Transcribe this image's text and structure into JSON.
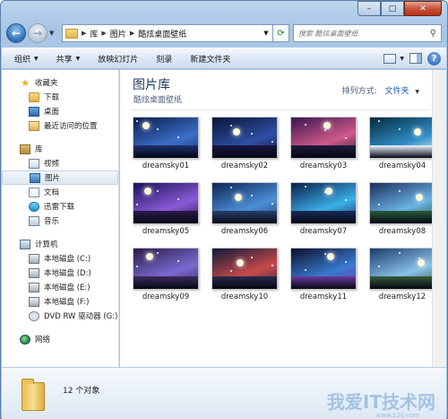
{
  "window": {
    "caption": {
      "minimize": "–",
      "maximize": "□",
      "close": "✕"
    }
  },
  "address": {
    "breadcrumbs": [
      "库",
      "图片",
      "酷炫桌面壁纸"
    ],
    "search_placeholder": "搜索 酷炫桌面壁纸"
  },
  "toolbar": {
    "organize": "组织",
    "share": "共享",
    "slideshow": "放映幻灯片",
    "burn": "刻录",
    "new_folder": "新建文件夹"
  },
  "nav": {
    "favorites": {
      "header": "收藏夹",
      "items": [
        "下载",
        "桌面",
        "最近访问的位置"
      ]
    },
    "libraries": {
      "header": "库",
      "items": [
        "视频",
        "图片",
        "文档",
        "迅雷下载",
        "音乐"
      ]
    },
    "computer": {
      "header": "计算机",
      "items": [
        "本地磁盘 (C:)",
        "本地磁盘 (D:)",
        "本地磁盘 (E:)",
        "本地磁盘 (F:)",
        "DVD RW 驱动器 (G:)"
      ]
    },
    "network": {
      "header": "网络"
    }
  },
  "content": {
    "library_title": "图片库",
    "library_subtitle": "酷炫桌面壁纸",
    "arrange_label": "排列方式:",
    "arrange_value": "文件夹",
    "files": [
      "dreamsky01",
      "dreamsky02",
      "dreamsky03",
      "dreamsky04",
      "dreamsky05",
      "dreamsky06",
      "dreamsky07",
      "dreamsky08",
      "dreamsky09",
      "dreamsky10",
      "dreamsky11",
      "dreamsky12"
    ]
  },
  "details": {
    "count": "12 个对象"
  },
  "watermark": {
    "text": "我爱IT技术网",
    "url": "www.52ij.com"
  }
}
